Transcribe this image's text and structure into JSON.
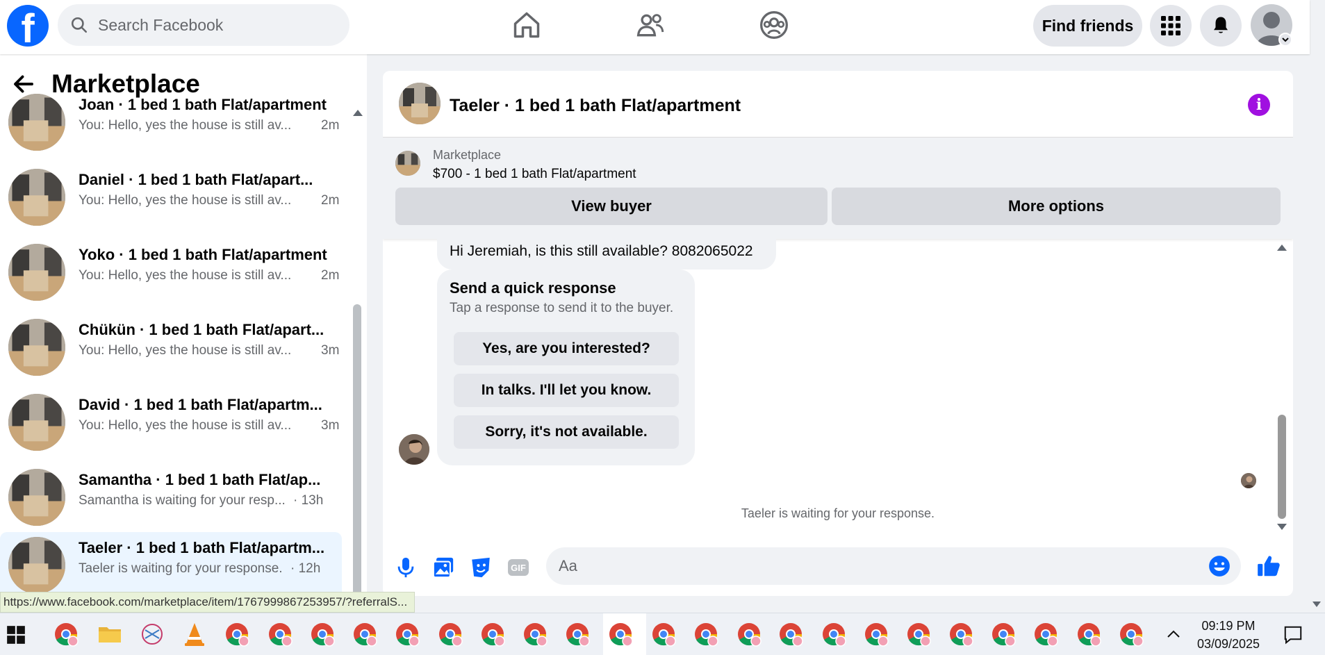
{
  "topbar": {
    "logo": "f",
    "search_placeholder": "Search Facebook",
    "find_friends": "Find friends"
  },
  "sidebar": {
    "title": "Marketplace",
    "conversations": [
      {
        "name": "Joan · 1 bed 1 bath Flat/apartment",
        "preview": "You: Hello, yes the house is still av...",
        "time": "2m",
        "active": false
      },
      {
        "name": "Daniel · 1 bed 1 bath Flat/apart...",
        "preview": "You: Hello, yes the house is still av...",
        "time": "2m",
        "active": false
      },
      {
        "name": "Yoko · 1 bed 1 bath Flat/apartment",
        "preview": "You: Hello, yes the house is still av...",
        "time": "2m",
        "active": false
      },
      {
        "name": "Chükün · 1 bed 1 bath Flat/apart...",
        "preview": "You: Hello, yes the house is still av...",
        "time": "3m",
        "active": false
      },
      {
        "name": "David · 1 bed 1 bath Flat/apartm...",
        "preview": "You: Hello, yes the house is still av...",
        "time": "3m",
        "active": false
      },
      {
        "name": "Samantha · 1 bed 1 bath Flat/ap...",
        "preview": "Samantha is waiting for your resp...",
        "time": "· 13h",
        "active": false
      },
      {
        "name": "Taeler · 1 bed 1 bath Flat/apartm...",
        "preview": "Taeler is waiting for your response.",
        "time": "· 12h",
        "active": true
      }
    ]
  },
  "chat": {
    "title": "Taeler · 1 bed 1 bath Flat/apartment",
    "listing_label": "Marketplace",
    "listing_price": "$700 - 1 bed 1 bath Flat/apartment",
    "view_buyer": "View buyer",
    "more_options": "More options",
    "buyer_message": "Hi Jeremiah, is this still available? 8082065022",
    "quick_title": "Send a quick response",
    "quick_subtitle": "Tap a response to send it to the buyer.",
    "quick_responses": [
      "Yes, are you interested?",
      "In talks. I'll let you know.",
      "Sorry, it's not available."
    ],
    "waiting_text": "Taeler is waiting for your response.",
    "composer_placeholder": "Aa",
    "gif_label": "GIF"
  },
  "status_url": "https://www.facebook.com/marketplace/item/1767999867253957/?referralS...",
  "taskbar": {
    "time": "09:19 PM",
    "date": "03/09/2025"
  },
  "colors": {
    "brand": "#0866ff",
    "info": "#a010e0",
    "active_row": "#ebf5ff"
  }
}
